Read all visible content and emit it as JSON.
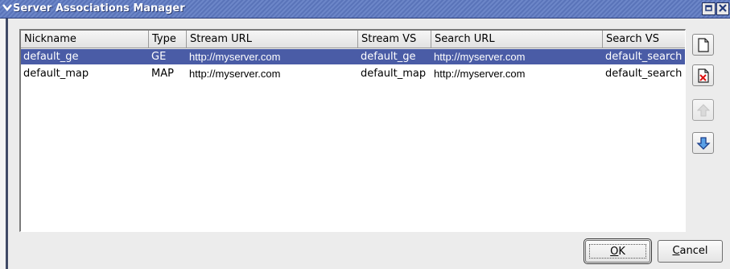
{
  "window": {
    "title": "Server Associations Manager",
    "menu_icon": "chevron-down-icon",
    "restore_icon": "restore-icon",
    "close_icon": "close-icon"
  },
  "table": {
    "columns": [
      "Nickname",
      "Type",
      "Stream URL",
      "Stream VS",
      "Search URL",
      "Search VS"
    ],
    "rows": [
      {
        "nickname": "default_ge",
        "type": "GE",
        "stream_url": "http://myserver.com",
        "stream_vs": "default_ge",
        "search_url": "http://myserver.com",
        "search_vs": "default_search",
        "selected": true
      },
      {
        "nickname": "default_map",
        "type": "MAP",
        "stream_url": "http://myserver.com",
        "stream_vs": "default_map",
        "search_url": "http://myserver.com",
        "search_vs": "default_search",
        "selected": false
      }
    ]
  },
  "side_buttons": [
    {
      "name": "new-document-icon",
      "enabled": true
    },
    {
      "name": "delete-document-icon",
      "enabled": true
    },
    {
      "name": "move-up-icon",
      "enabled": false
    },
    {
      "name": "move-down-icon",
      "enabled": true
    }
  ],
  "buttons": {
    "ok_mnemonic": "O",
    "ok_rest": "K",
    "cancel_mnemonic": "C",
    "cancel_rest": "ancel"
  },
  "colors": {
    "selection": "#4a5ca6",
    "titlebar": "#5a74b9"
  }
}
